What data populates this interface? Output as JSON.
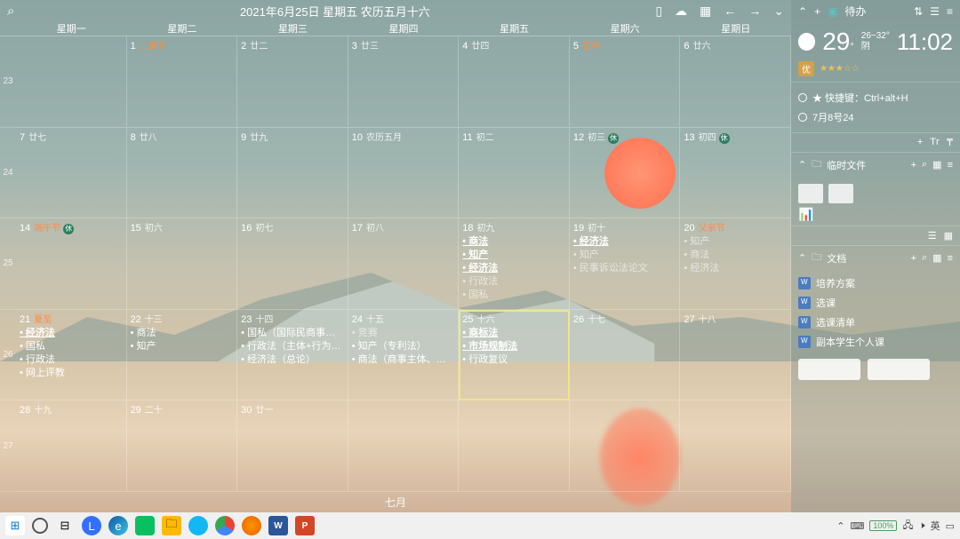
{
  "topbar": {
    "title": "2021年6月25日 星期五 农历五月十六"
  },
  "dayHeaders": [
    "星期一",
    "星期二",
    "星期三",
    "星期四",
    "星期五",
    "星期六",
    "星期日"
  ],
  "weekNumbers": [
    "23",
    "24",
    "25",
    "26",
    "27"
  ],
  "nextMonth": "七月",
  "sidebar": {
    "todoTitle": "待办",
    "temp": "29",
    "tempUnit": "°",
    "range": "26~32°",
    "clock": "11:02",
    "cond": "阴",
    "aqi": "优",
    "stars": "★★★☆☆",
    "todo1": "★ 快捷键：Ctrl+alt+H",
    "todo2": "7月8号24",
    "sec1": "临时文件",
    "sec2": "文档",
    "docs": [
      "培养方案",
      "选课",
      "选课清单",
      "副本学生个人课"
    ]
  },
  "tray": {
    "battery": "100%"
  },
  "cells": [
    {
      "d": "",
      "l": ""
    },
    {
      "d": "1",
      "l": "儿童节",
      "hl": 1
    },
    {
      "d": "2",
      "l": "廿二"
    },
    {
      "d": "3",
      "l": "廿三"
    },
    {
      "d": "4",
      "l": "廿四"
    },
    {
      "d": "5",
      "l": "芒种",
      "hl": 1
    },
    {
      "d": "6",
      "l": "廿六"
    },
    {
      "d": "7",
      "l": "廿七"
    },
    {
      "d": "8",
      "l": "廿八"
    },
    {
      "d": "9",
      "l": "廿九"
    },
    {
      "d": "10",
      "l": "农历五月"
    },
    {
      "d": "11",
      "l": "初二"
    },
    {
      "d": "12",
      "l": "初三",
      "holi": "休"
    },
    {
      "d": "13",
      "l": "初四",
      "holi": "休"
    },
    {
      "d": "14",
      "l": "端午节",
      "hl": 1,
      "holi": "休"
    },
    {
      "d": "15",
      "l": "初六"
    },
    {
      "d": "16",
      "l": "初七"
    },
    {
      "d": "17",
      "l": "初八"
    },
    {
      "d": "18",
      "l": "初九",
      "ev": [
        {
          "t": "商法",
          "s": 1
        },
        {
          "t": "知产",
          "s": 1
        },
        {
          "t": "经济法",
          "s": 1
        },
        {
          "t": "行政法",
          "dim": 1
        },
        {
          "t": "国私",
          "dim": 1
        }
      ]
    },
    {
      "d": "19",
      "l": "初十",
      "ev": [
        {
          "t": "经济法",
          "s": 1
        },
        {
          "t": "知产",
          "dim": 1
        },
        {
          "t": "民事诉讼法论文",
          "dim": 1
        }
      ]
    },
    {
      "d": "20",
      "l": "父亲节",
      "hl": 1,
      "ev": [
        {
          "t": "知产",
          "dim": 1
        },
        {
          "t": "商法",
          "dim": 1
        },
        {
          "t": "经济法",
          "dim": 1
        }
      ]
    },
    {
      "d": "21",
      "l": "夏至",
      "hl": 1,
      "ev": [
        {
          "t": "经济法",
          "s": 1
        },
        {
          "t": "国私"
        },
        {
          "t": "行政法"
        },
        {
          "t": "网上评教"
        }
      ]
    },
    {
      "d": "22",
      "l": "十三",
      "ev": [
        {
          "t": "商法"
        },
        {
          "t": "知产"
        }
      ]
    },
    {
      "d": "23",
      "l": "十四",
      "ev": [
        {
          "t": "国私（国际民商事法律关系适用）"
        },
        {
          "t": "行政法（主体+行为+程序）"
        },
        {
          "t": "经济法（总论）"
        }
      ]
    },
    {
      "d": "24",
      "l": "十五",
      "ev": [
        {
          "t": "竞赛",
          "dim": 1
        },
        {
          "t": "知产（专利法）"
        },
        {
          "t": "商法（商事主体、监管）"
        }
      ]
    },
    {
      "d": "25",
      "l": "十六",
      "today": 1,
      "ev": [
        {
          "t": "商标法",
          "s": 1
        },
        {
          "t": "市场规制法",
          "s": 1
        },
        {
          "t": "行政复议"
        }
      ]
    },
    {
      "d": "26",
      "l": "十七"
    },
    {
      "d": "27",
      "l": "十八"
    },
    {
      "d": "28",
      "l": "十九"
    },
    {
      "d": "29",
      "l": "二十"
    },
    {
      "d": "30",
      "l": "廿一"
    },
    {
      "d": "",
      "l": ""
    },
    {
      "d": "",
      "l": ""
    },
    {
      "d": "",
      "l": ""
    },
    {
      "d": "",
      "l": ""
    }
  ]
}
